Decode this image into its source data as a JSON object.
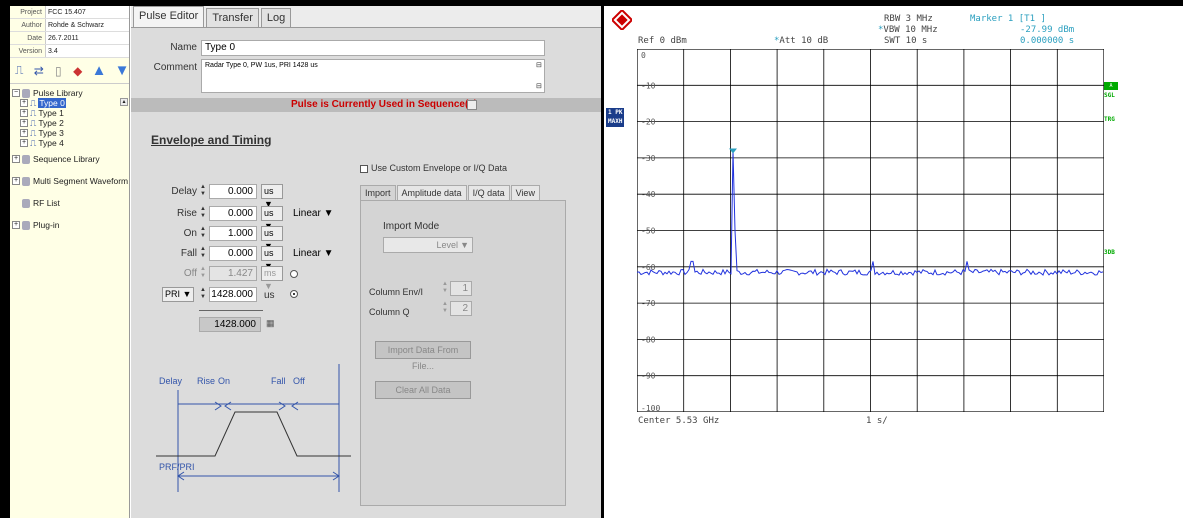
{
  "sidebar": {
    "meta": [
      {
        "key": "Project",
        "value": "FCC 15.407"
      },
      {
        "key": "Author",
        "value": "Rohde & Schwarz"
      },
      {
        "key": "Date",
        "value": "26.7.2011"
      },
      {
        "key": "Version",
        "value": "3.4"
      }
    ],
    "tree": {
      "pulse_library": "Pulse Library",
      "types": [
        "Type 0",
        "Type 1",
        "Type 2",
        "Type 3",
        "Type 4"
      ],
      "sequence_library": "Sequence Library",
      "multi_segment": "Multi Segment Waveform",
      "rf_list": "RF List",
      "plug_in": "Plug-in"
    }
  },
  "editor": {
    "tabs": [
      "Pulse Editor",
      "Transfer",
      "Log"
    ],
    "name_label": "Name",
    "name_value": "Type 0",
    "comment_label": "Comment",
    "comment_value": "Radar Type 0, PW 1us, PRI 1428 us",
    "banner": "Pulse is Currently Used in Sequence(s)",
    "section_title": "Envelope and Timing",
    "custom_envelope_label": "Use Custom Envelope or I/Q Data",
    "params": [
      {
        "label": "Delay",
        "value": "0.000",
        "unit": "us"
      },
      {
        "label": "Rise",
        "value": "0.000",
        "unit": "us",
        "shape": "Linear"
      },
      {
        "label": "On",
        "value": "1.000",
        "unit": "us"
      },
      {
        "label": "Fall",
        "value": "0.000",
        "unit": "us",
        "shape": "Linear"
      },
      {
        "label": "Off",
        "value": "1.427",
        "unit": "ms"
      },
      {
        "label": "PRI",
        "value": "1428.000",
        "unit": "us"
      }
    ],
    "result_value": "1428.000",
    "subtabs": [
      "Import",
      "Amplitude data",
      "I/Q data",
      "View"
    ],
    "import_mode_label": "Import Mode",
    "import_mode_value": "Level",
    "column_env_label": "Column Env/I",
    "column_env_value": "1",
    "column_q_label": "Column Q",
    "column_q_value": "2",
    "import_button": "Import Data From File...",
    "clear_button": "Clear All Data",
    "diagram_labels": {
      "delay": "Delay",
      "rise": "Rise",
      "on": "On",
      "fall": "Fall",
      "off": "Off",
      "prf": "PRF/PRI"
    }
  },
  "analyzer": {
    "rbw": "RBW 3 MHz",
    "vbw": "VBW 10 MHz",
    "swt": "SWT 10 s",
    "marker": "Marker 1 [T1 ]",
    "marker_level": "-27.99 dBm",
    "marker_time": "0.000000 s",
    "ref": "Ref  0 dBm",
    "att": "Att  10 dB",
    "center": "Center 5.53 GHz",
    "span": "1 s/",
    "badge_1pk": "1 PK",
    "badge_maxh": "MAXH",
    "side_a": "A",
    "side_sgl": "SGL",
    "side_trg": "TRG",
    "side_3db": "3DB",
    "y_labels": [
      "0",
      "-10",
      "-20",
      "-30",
      "-40",
      "-50",
      "-60",
      "-70",
      "-80",
      "-90",
      "-100"
    ],
    "colors": {
      "trace": "#2233dd",
      "marker": "#2a9fbf",
      "grid": "#000000"
    }
  }
}
